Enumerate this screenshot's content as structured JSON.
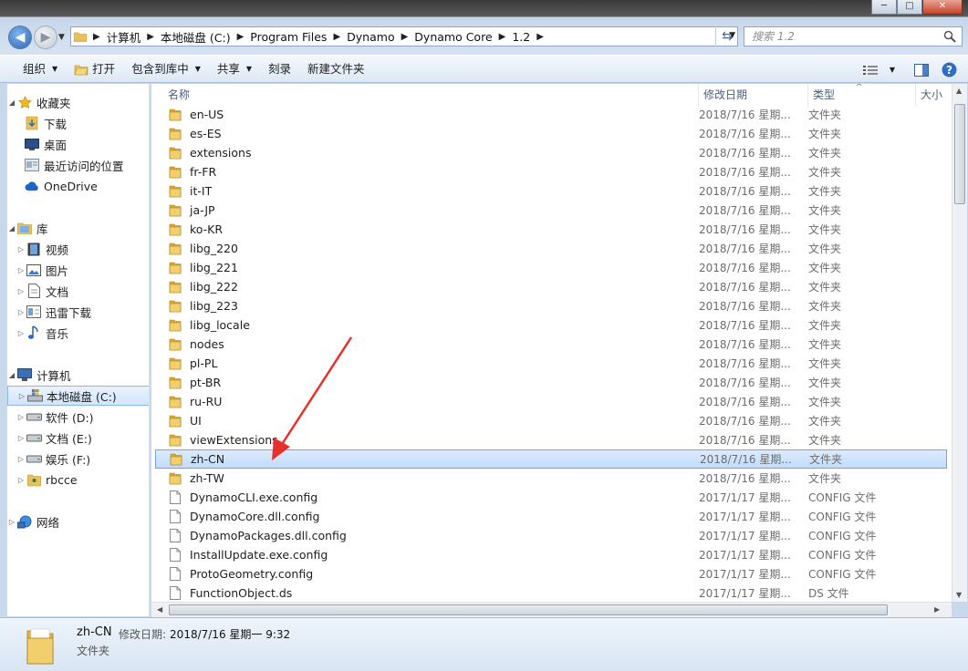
{
  "window": {
    "minimize_label": "─",
    "maximize_label": "□",
    "close_label": "✕"
  },
  "address": {
    "crumbs": [
      "计算机",
      "本地磁盘 (C:)",
      "Program Files",
      "Dynamo",
      "Dynamo Core",
      "1.2"
    ],
    "search_placeholder": "搜索 1.2"
  },
  "toolbar": {
    "organize": "组织",
    "open": "打开",
    "include_library": "包含到库中",
    "share": "共享",
    "burn": "刻录",
    "new_folder": "新建文件夹"
  },
  "nav": {
    "favorites": "收藏夹",
    "downloads": "下载",
    "desktop": "桌面",
    "recent": "最近访问的位置",
    "onedrive": "OneDrive",
    "libraries": "库",
    "videos": "视频",
    "pictures": "图片",
    "documents": "文档",
    "thunder": "迅雷下载",
    "music": "音乐",
    "computer": "计算机",
    "drive_c": "本地磁盘 (C:)",
    "drive_d": "软件 (D:)",
    "drive_e": "文档 (E:)",
    "drive_f": "娱乐 (F:)",
    "rbcce": "rbcce",
    "network": "网络"
  },
  "columns": {
    "name": "名称",
    "modified": "修改日期",
    "type": "类型",
    "size": "大小"
  },
  "files": [
    {
      "name": "en-US",
      "date": "2018/7/16 星期...",
      "type": "文件夹",
      "kind": "folder"
    },
    {
      "name": "es-ES",
      "date": "2018/7/16 星期...",
      "type": "文件夹",
      "kind": "folder"
    },
    {
      "name": "extensions",
      "date": "2018/7/16 星期...",
      "type": "文件夹",
      "kind": "folder"
    },
    {
      "name": "fr-FR",
      "date": "2018/7/16 星期...",
      "type": "文件夹",
      "kind": "folder"
    },
    {
      "name": "it-IT",
      "date": "2018/7/16 星期...",
      "type": "文件夹",
      "kind": "folder"
    },
    {
      "name": "ja-JP",
      "date": "2018/7/16 星期...",
      "type": "文件夹",
      "kind": "folder"
    },
    {
      "name": "ko-KR",
      "date": "2018/7/16 星期...",
      "type": "文件夹",
      "kind": "folder"
    },
    {
      "name": "libg_220",
      "date": "2018/7/16 星期...",
      "type": "文件夹",
      "kind": "folder"
    },
    {
      "name": "libg_221",
      "date": "2018/7/16 星期...",
      "type": "文件夹",
      "kind": "folder"
    },
    {
      "name": "libg_222",
      "date": "2018/7/16 星期...",
      "type": "文件夹",
      "kind": "folder"
    },
    {
      "name": "libg_223",
      "date": "2018/7/16 星期...",
      "type": "文件夹",
      "kind": "folder"
    },
    {
      "name": "libg_locale",
      "date": "2018/7/16 星期...",
      "type": "文件夹",
      "kind": "folder"
    },
    {
      "name": "nodes",
      "date": "2018/7/16 星期...",
      "type": "文件夹",
      "kind": "folder"
    },
    {
      "name": "pl-PL",
      "date": "2018/7/16 星期...",
      "type": "文件夹",
      "kind": "folder"
    },
    {
      "name": "pt-BR",
      "date": "2018/7/16 星期...",
      "type": "文件夹",
      "kind": "folder"
    },
    {
      "name": "ru-RU",
      "date": "2018/7/16 星期...",
      "type": "文件夹",
      "kind": "folder"
    },
    {
      "name": "UI",
      "date": "2018/7/16 星期...",
      "type": "文件夹",
      "kind": "folder"
    },
    {
      "name": "viewExtensions",
      "date": "2018/7/16 星期...",
      "type": "文件夹",
      "kind": "folder"
    },
    {
      "name": "zh-CN",
      "date": "2018/7/16 星期...",
      "type": "文件夹",
      "kind": "folder",
      "selected": true
    },
    {
      "name": "zh-TW",
      "date": "2018/7/16 星期...",
      "type": "文件夹",
      "kind": "folder"
    },
    {
      "name": "DynamoCLI.exe.config",
      "date": "2017/1/17 星期...",
      "type": "CONFIG 文件",
      "kind": "file"
    },
    {
      "name": "DynamoCore.dll.config",
      "date": "2017/1/17 星期...",
      "type": "CONFIG 文件",
      "kind": "file"
    },
    {
      "name": "DynamoPackages.dll.config",
      "date": "2017/1/17 星期...",
      "type": "CONFIG 文件",
      "kind": "file"
    },
    {
      "name": "InstallUpdate.exe.config",
      "date": "2017/1/17 星期...",
      "type": "CONFIG 文件",
      "kind": "file"
    },
    {
      "name": "ProtoGeometry.config",
      "date": "2017/1/17 星期...",
      "type": "CONFIG 文件",
      "kind": "file"
    },
    {
      "name": "FunctionObject.ds",
      "date": "2017/1/17 星期...",
      "type": "DS 文件",
      "kind": "file"
    }
  ],
  "details": {
    "name": "zh-CN",
    "modified_label": "修改日期:",
    "modified_value": "2018/7/16 星期一 9:32",
    "type": "文件夹"
  },
  "colors": {
    "selection": "#cce4fb",
    "annotation_arrow": "#e8302a",
    "folder": "#e8c15a"
  }
}
